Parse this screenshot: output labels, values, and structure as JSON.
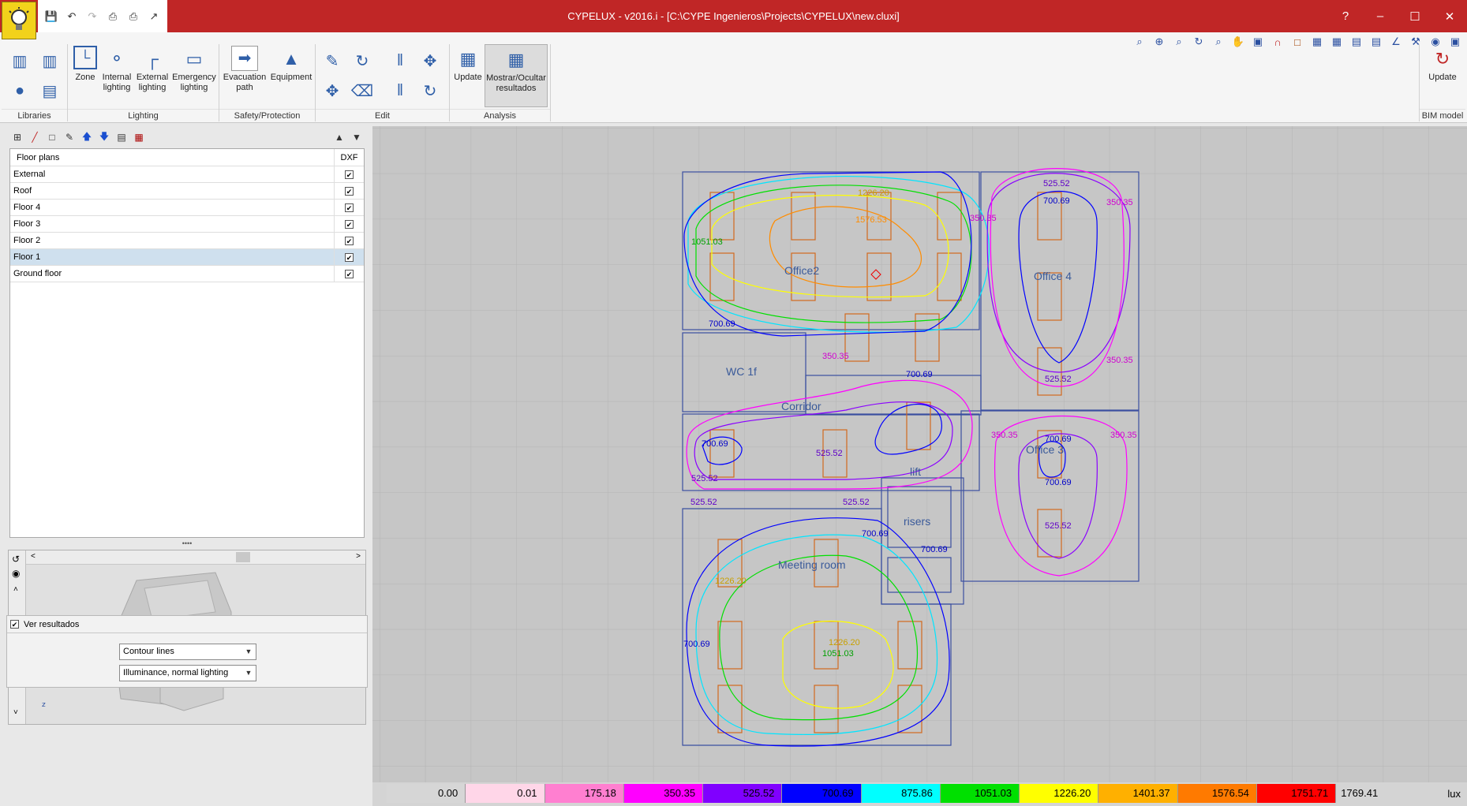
{
  "window": {
    "title": "CYPELUX - v2016.i - [C:\\CYPE Ingenieros\\Projects\\CYPELUX\\new.cluxi]",
    "help": "?",
    "minimize": "–",
    "maximize": "☐",
    "close": "✕"
  },
  "ribbon": {
    "groups": {
      "libraries": "Libraries",
      "lighting": "Lighting",
      "safety": "Safety/Protection",
      "edit": "Edit",
      "analysis": "Analysis",
      "bim": "BIM model"
    },
    "buttons": {
      "zone": "Zone",
      "internal_lighting": "Internal lighting",
      "external_lighting": "External lighting",
      "emergency_lighting": "Emergency lighting",
      "evacuation_path": "Evacuation path",
      "equipment": "Equipment",
      "update": "Update",
      "show_hide_results": "Mostrar/Ocultar resultados",
      "bim_update": "Update"
    }
  },
  "floor_plans": {
    "header": "Floor plans",
    "dxf_header": "DXF",
    "rows": [
      {
        "name": "External",
        "dxf": "✔"
      },
      {
        "name": "Roof",
        "dxf": "✔"
      },
      {
        "name": "Floor 4",
        "dxf": "✔"
      },
      {
        "name": "Floor 3",
        "dxf": "✔"
      },
      {
        "name": "Floor 2",
        "dxf": "✔"
      },
      {
        "name": "Floor 1",
        "dxf": "✔"
      },
      {
        "name": "Ground floor",
        "dxf": "✔"
      }
    ],
    "selected": "Floor 1"
  },
  "results": {
    "checkbox_label": "Ver resultados",
    "checked": "✔",
    "display_mode": "Contour lines",
    "magnitude": "Illuminance, normal lighting"
  },
  "rooms": {
    "office2": "Office2",
    "office4": "Office 4",
    "office3": "Office 3",
    "wc": "WC 1f",
    "corridor": "Corridor",
    "lift": "lift",
    "risers": "risers",
    "meeting": "Meeting room"
  },
  "contour_labels": {
    "c1": "1226.20",
    "c2": "1576.53",
    "c3": "1051.03",
    "c4": "700.69",
    "c5": "525.52",
    "c6": "700.69",
    "c7": "350.35",
    "c8": "350.35",
    "c9": "525.52",
    "c10": "350.35",
    "c11": "700.69",
    "c12": "700.69",
    "c13": "525.52",
    "c14": "350.35",
    "c15": "700.69",
    "c16": "700.69",
    "c17": "525.52",
    "c18": "350.35",
    "c19": "350.35",
    "c20": "525.52",
    "c21": "525.52",
    "c22": "700.69",
    "c23": "700.69",
    "c24": "1226.20",
    "c25": "1226.20",
    "c26": "1051.03",
    "c27": "700.69",
    "c28": "525.52"
  },
  "legend": {
    "unit": "lux",
    "steps": [
      {
        "label": "0.00",
        "color": "#d6d6d6"
      },
      {
        "label": "0.01",
        "color": "#ffd6e8"
      },
      {
        "label": "175.18",
        "color": "#ff7fd0"
      },
      {
        "label": "350.35",
        "color": "#ff00ff"
      },
      {
        "label": "525.52",
        "color": "#8000ff"
      },
      {
        "label": "700.69",
        "color": "#0000ff"
      },
      {
        "label": "875.86",
        "color": "#00ffff"
      },
      {
        "label": "1051.03",
        "color": "#00e000"
      },
      {
        "label": "1226.20",
        "color": "#ffff00"
      },
      {
        "label": "1401.37",
        "color": "#ffb000"
      },
      {
        "label": "1576.54",
        "color": "#ff7a00"
      },
      {
        "label": "1751.71",
        "color": "#ff0000"
      },
      {
        "label": "1769.41",
        "color": "#d6d6d6"
      }
    ]
  }
}
